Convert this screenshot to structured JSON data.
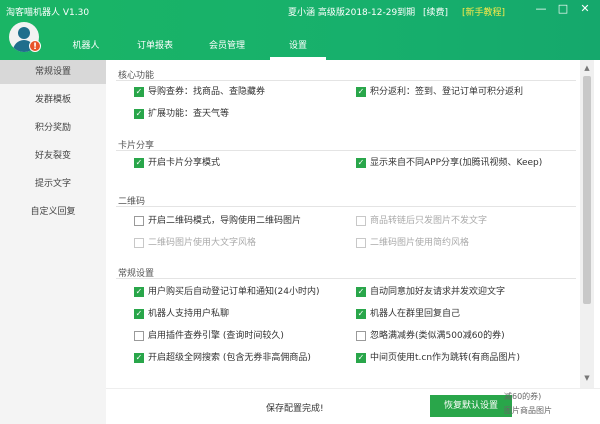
{
  "app": {
    "title": "淘客喵机器人 V1.30"
  },
  "user": {
    "info": "夏小涵 高级版2018-12-29到期",
    "renew": "[续费]",
    "tutorial": "[新手教程]",
    "badge": "!"
  },
  "window_controls": [
    "—",
    "□",
    "✕"
  ],
  "tabs": [
    {
      "label": "机器人",
      "active": false
    },
    {
      "label": "订单报表",
      "active": false
    },
    {
      "label": "会员管理",
      "active": false
    },
    {
      "label": "设置",
      "active": true
    }
  ],
  "sidebar": [
    {
      "label": "常规设置",
      "active": true
    },
    {
      "label": "发群模板",
      "active": false
    },
    {
      "label": "积分奖励",
      "active": false
    },
    {
      "label": "好友裂变",
      "active": false
    },
    {
      "label": "提示文字",
      "active": false
    },
    {
      "label": "自定义回复",
      "active": false
    }
  ],
  "sections": {
    "core": {
      "title": "核心功能",
      "options": [
        {
          "label": "导购查券：找商品、查隐藏券",
          "checked": true
        },
        {
          "label": "积分返利：签到、登记订单可积分返利",
          "checked": true
        },
        {
          "label": "扩展功能：查天气等",
          "checked": true
        }
      ]
    },
    "card": {
      "title": "卡片分享",
      "options": [
        {
          "label": "开启卡片分享模式",
          "checked": true
        },
        {
          "label": "显示来自不同APP分享(加腾讯视频、Keep)",
          "checked": true
        }
      ]
    },
    "qr": {
      "title": "二维码",
      "options": [
        {
          "label": "开启二维码模式，导购使用二维码图片",
          "checked": false,
          "disabled": false
        },
        {
          "label": "商品转链后只发图片不发文字",
          "checked": false,
          "disabled": true
        },
        {
          "label": "二维码图片使用大文字风格",
          "checked": false,
          "disabled": true
        },
        {
          "label": "二维码图片使用简约风格",
          "checked": false,
          "disabled": true
        }
      ]
    },
    "general": {
      "title": "常规设置",
      "options": [
        {
          "label": "用户购买后自动登记订单和通知(24小时内)",
          "checked": true
        },
        {
          "label": "自动同意加好友请求并发欢迎文字",
          "checked": true
        },
        {
          "label": "机器人支持用户私聊",
          "checked": true
        },
        {
          "label": "机器人在群里回复自己",
          "checked": true
        },
        {
          "label": "启用插件查券引擎 (查询时间较久)",
          "checked": false
        },
        {
          "label": "忽略满减券(类似满500减60的券)",
          "checked": false
        },
        {
          "label": "开启超级全网搜索 (包含无券非高佣商品)",
          "checked": true
        },
        {
          "label": "中间页使用t.cn作为跳转(有商品图片)",
          "checked": true
        }
      ]
    }
  },
  "footer": {
    "status": "保存配置完成!",
    "reset_label": "恢复默认设置",
    "overflow_text_1": "减60的券)",
    "overflow_text_2": "图片商品图片"
  },
  "colors": {
    "header": "#1ab565",
    "accent": "#29a64a",
    "tutorial": "#f9e94a",
    "badge": "#e8552a"
  }
}
